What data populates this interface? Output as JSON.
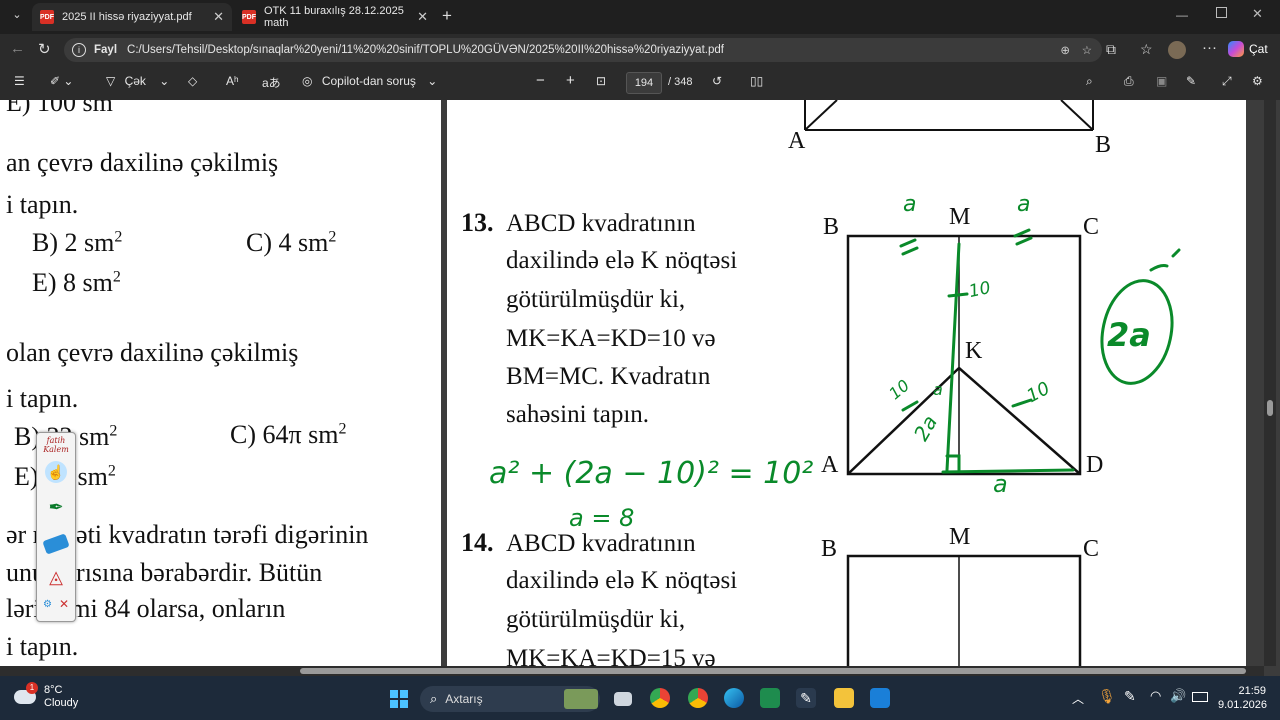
{
  "tabs": [
    {
      "label": "2025 II hissə riyaziyyat.pdf",
      "active": true
    },
    {
      "label": "OTK 11 buraxılış 28.12.2025 math",
      "active": false
    }
  ],
  "address": {
    "scheme_label": "Fayl",
    "url": "C:/Users/Tehsil/Desktop/sınaqlar%20yeni/11%20%20sinif/TOPLU%20GÜVƏN/2025%20II%20hissə%20riyaziyyat.pdf"
  },
  "browser": {
    "copilot_label": "Çat"
  },
  "pdf_toolbar": {
    "draw_label": "Çək",
    "read_aloud_label": "Aʰ",
    "translate_label": "aあ",
    "copilot_label": "Copilot-dan soruş",
    "zoom_out": "−",
    "zoom_in": "+",
    "page_current": "194",
    "page_total": "/ 348"
  },
  "left_page": {
    "line0": "E) 100 sm",
    "line1": "an çevrə daxilinə çəkilmiş",
    "line2": "i tapın.",
    "b1": "B) 2 sm",
    "b1_sup": "2",
    "c1": "C) 4 sm",
    "c1_sup": "2",
    "e1": "E) 8  sm",
    "e1_sup": "2",
    "line3": "olan çevrə daxilinə çəkilmiş",
    "line4": "i tapın.",
    "b2": "B) 32 sm",
    "b2_sup": "2",
    "c2": "C) 64π sm",
    "c2_sup": "2",
    "e2": "E) 16 sm",
    "e2_sup": "2",
    "line5": "ər nisbəti kvadratın tərəfi digərinin",
    "line6": "unu yarısına bərabərdir. Bütün",
    "line7": "ləri cəmi 84 olarsa, onların",
    "line8": "i tapın."
  },
  "right_page": {
    "top_label_a": "A",
    "top_label_b": "B",
    "q13_num": "13.",
    "q13_lines": [
      "ABCD kvadratının",
      "daxilində elə K nöqtəsi",
      "götürülmüşdür ki,",
      "MK=KA=KD=10 və",
      "BM=MC. Kvadratın",
      "sahəsini tapın."
    ],
    "fig13": {
      "b": "B",
      "m": "M",
      "c": "C",
      "k": "K",
      "a": "A",
      "d": "D"
    },
    "q14_num": "14.",
    "q14_lines": [
      "ABCD kvadratının",
      "daxilində elə K nöqtəsi",
      "götürülmüşdür ki,",
      "MK=KA=KD=15 və"
    ],
    "fig14": {
      "b": "B",
      "m": "M",
      "c": "C"
    },
    "handwriting": {
      "eq": "a² + (2a − 10)² = 10²",
      "result": "a = 8",
      "circled": "2a",
      "ten1": "10",
      "ten2": "10",
      "ten3": "10",
      "a_top1": "a",
      "a_top2": "a",
      "a_bottom": "a",
      "left_a": "a",
      "two_a": "2a"
    }
  },
  "kalem": {
    "title": "fatih Kalem"
  },
  "taskbar": {
    "temp": "8°C",
    "weather": "Cloudy",
    "search_label": "Axtarış",
    "time": "21:59",
    "date": "9.01.2026",
    "weather_badge": "1"
  },
  "colors": {
    "ink": "#0a8a2a",
    "accent": "#0a6dd1",
    "pdf_red": "#d93025"
  }
}
